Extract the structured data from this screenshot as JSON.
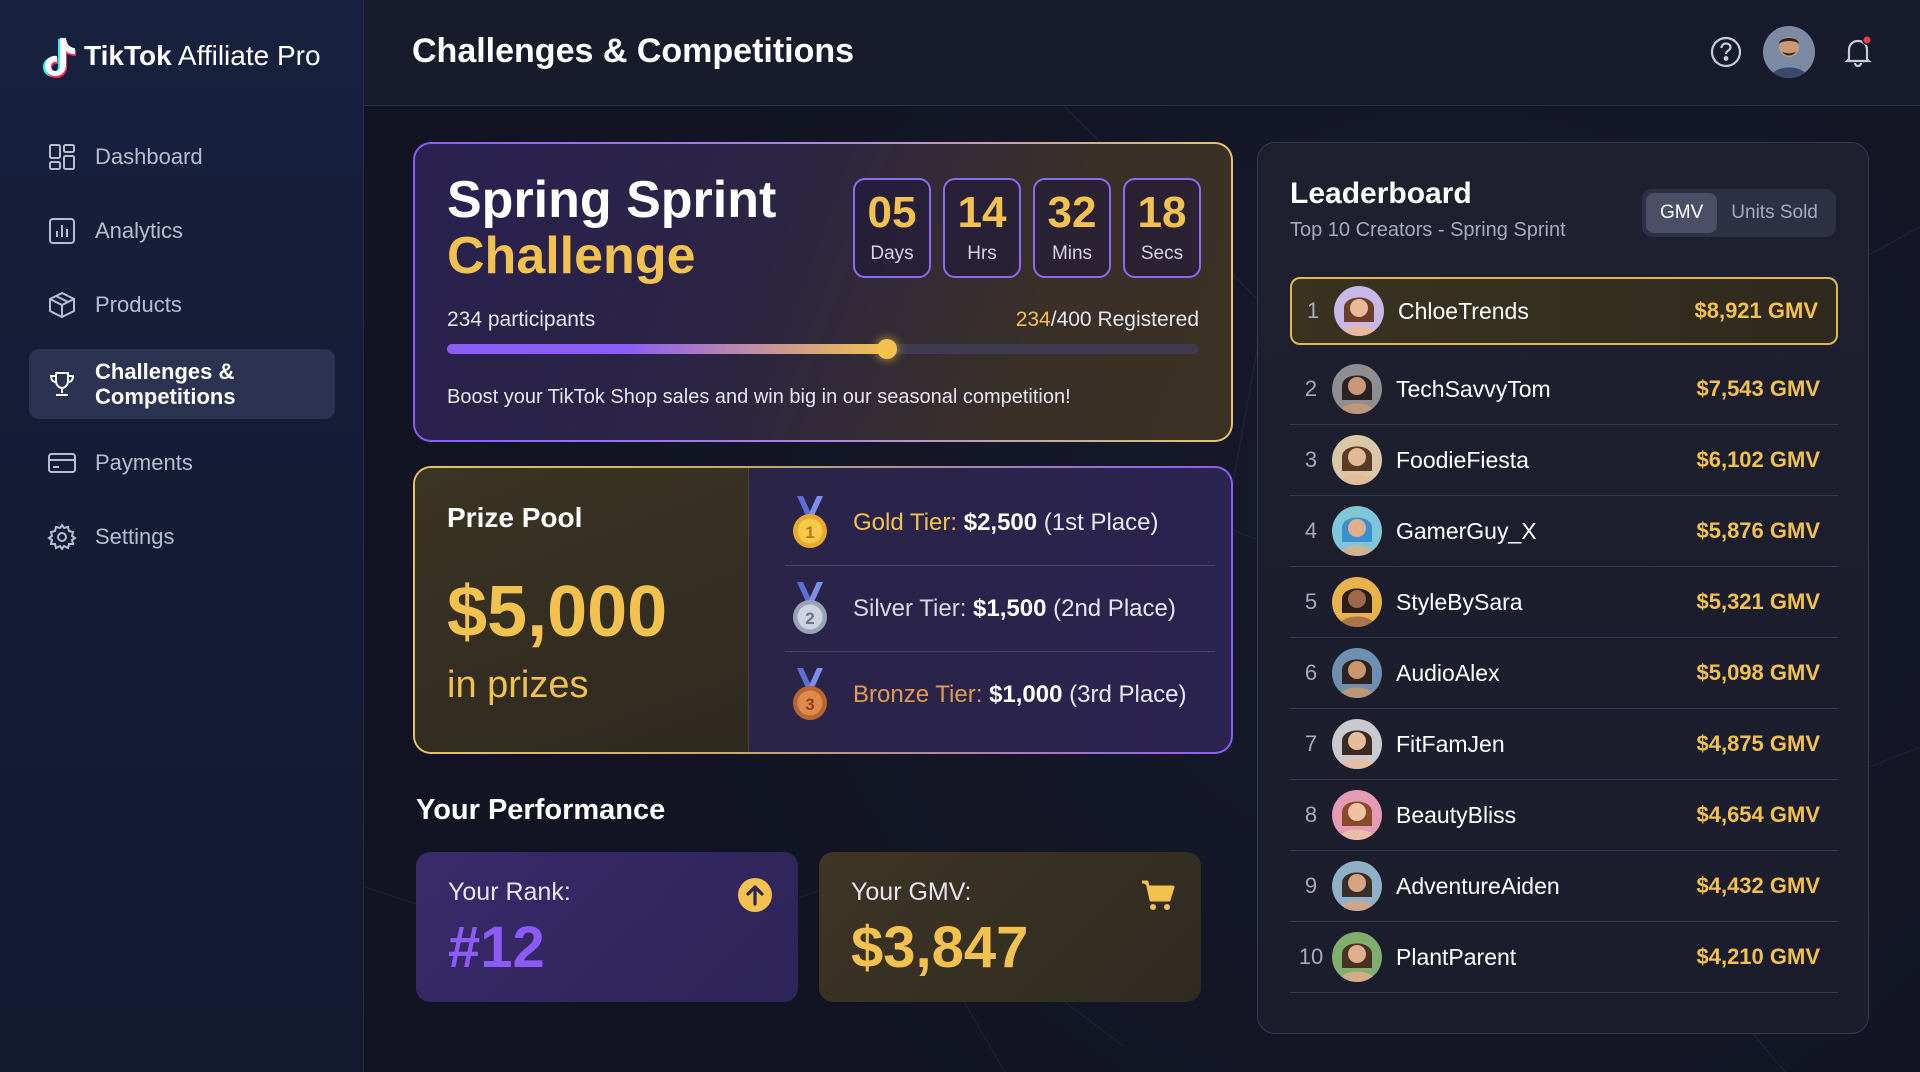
{
  "brand": {
    "bold": "TikTok",
    "regular": " Affiliate Pro"
  },
  "nav": [
    {
      "label": "Dashboard",
      "icon": "dashboard-icon"
    },
    {
      "label": "Analytics",
      "icon": "analytics-icon"
    },
    {
      "label": "Products",
      "icon": "box-icon"
    },
    {
      "label": "Challenges &\nCompetitions",
      "icon": "trophy-icon",
      "active": true
    },
    {
      "label": "Payments",
      "icon": "credit-card-icon"
    },
    {
      "label": "Settings",
      "icon": "gear-icon"
    }
  ],
  "header": {
    "title": "Challenges & Competitions"
  },
  "challenge": {
    "title_line1": "Spring Sprint",
    "title_line2": "Challenge",
    "countdown": [
      {
        "value": "05",
        "unit": "Days"
      },
      {
        "value": "14",
        "unit": "Hrs"
      },
      {
        "value": "32",
        "unit": "Mins"
      },
      {
        "value": "18",
        "unit": "Secs"
      }
    ],
    "participants": "234 participants",
    "registered_count": "234",
    "registered_rest": "/400 Registered",
    "progress": 0.585,
    "description": "Boost your TikTok Shop sales and win big in our seasonal competition!"
  },
  "prize": {
    "label": "Prize Pool",
    "amount": "$5,000",
    "sub": "in prizes",
    "tiers": [
      {
        "name": "Gold Tier:",
        "amount": "$2,500",
        "place": " (1st Place)",
        "medal": "1",
        "style": "gold"
      },
      {
        "name": "Silver Tier:",
        "amount": "$1,500",
        "place": " (2nd Place)",
        "medal": "2",
        "style": "silver"
      },
      {
        "name": "Bronze Tier:",
        "amount": "$1,000",
        "place": " (3rd Place)",
        "medal": "3",
        "style": "bronze"
      }
    ]
  },
  "performance": {
    "title": "Your Performance",
    "rank_label": "Your Rank:",
    "rank_value": "#12",
    "gmv_label": "Your GMV:",
    "gmv_value": "$3,847"
  },
  "leaderboard": {
    "title": "Leaderboard",
    "subtitle": "Top 10 Creators - Spring Sprint",
    "toggle": [
      "GMV",
      "Units Sold"
    ],
    "rows": [
      {
        "rank": "1",
        "name": "ChloeTrends",
        "gmv": "$8,921 GMV",
        "skin": "#e9b99a",
        "hair": "#6b3f2a",
        "bg": "#c7b8e8"
      },
      {
        "rank": "2",
        "name": "TechSavvyTom",
        "gmv": "$7,543 GMV",
        "skin": "#c89878",
        "hair": "#2a2220",
        "bg": "#8d8d92"
      },
      {
        "rank": "3",
        "name": "FoodieFiesta",
        "gmv": "$6,102 GMV",
        "skin": "#e3b894",
        "hair": "#5a3a25",
        "bg": "#d9c7a8"
      },
      {
        "rank": "4",
        "name": "GamerGuy_X",
        "gmv": "$5,876 GMV",
        "skin": "#e0ae88",
        "hair": "#3a8fd0",
        "bg": "#7fc6d8"
      },
      {
        "rank": "5",
        "name": "StyleBySara",
        "gmv": "$5,321 GMV",
        "skin": "#9c6a4a",
        "hair": "#2b1c14",
        "bg": "#e8b24a"
      },
      {
        "rank": "6",
        "name": "AudioAlex",
        "gmv": "$5,098 GMV",
        "skin": "#c9966f",
        "hair": "#2c2420",
        "bg": "#6f8fb0"
      },
      {
        "rank": "7",
        "name": "FitFamJen",
        "gmv": "$4,875 GMV",
        "skin": "#e7bc9c",
        "hair": "#3a2a22",
        "bg": "#c9c9cf"
      },
      {
        "rank": "8",
        "name": "BeautyBliss",
        "gmv": "$4,654 GMV",
        "skin": "#efc2a6",
        "hair": "#8a4a2a",
        "bg": "#e59bb3"
      },
      {
        "rank": "9",
        "name": "AdventureAiden",
        "gmv": "$4,432 GMV",
        "skin": "#d6a584",
        "hair": "#3a2e26",
        "bg": "#8fb1c8"
      },
      {
        "rank": "10",
        "name": "PlantParent",
        "gmv": "$4,210 GMV",
        "skin": "#dfae8c",
        "hair": "#4a3020",
        "bg": "#7fae6f"
      }
    ]
  },
  "colors": {
    "accent_purple": "#8b5cf6",
    "accent_gold": "#f2c14e",
    "sidebar_bg": "#17203d"
  }
}
